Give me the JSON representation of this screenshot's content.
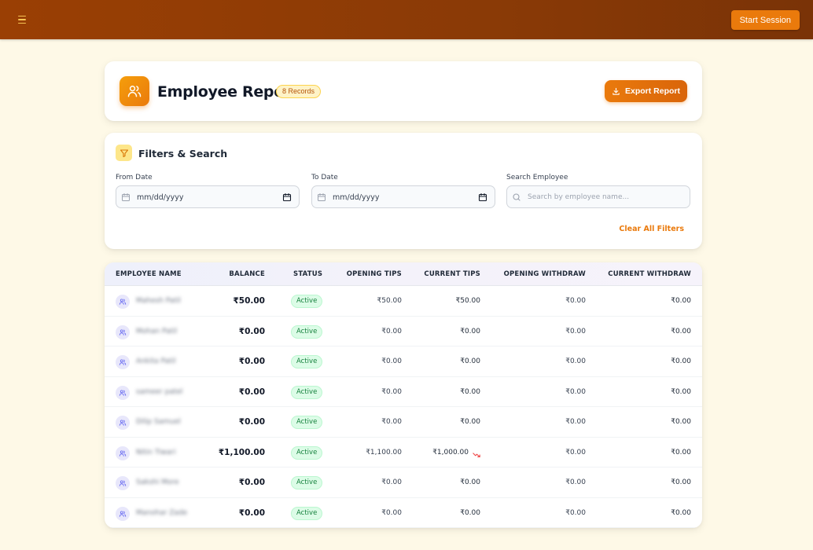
{
  "topbar": {
    "start_session_label": "Start Session"
  },
  "header": {
    "title": "Employee Report",
    "records_badge": "8 Records",
    "export_label": "Export Report"
  },
  "filters": {
    "title": "Filters & Search",
    "from_label": "From Date",
    "from_value": "mm/dd/yyyy",
    "to_label": "To Date",
    "to_value": "mm/dd/yyyy",
    "search_label": "Search Employee",
    "search_placeholder": "Search by employee name...",
    "clear_label": "Clear All Filters"
  },
  "table": {
    "headers": [
      "EMPLOYEE NAME",
      "BALANCE",
      "STATUS",
      "OPENING TIPS",
      "CURRENT TIPS",
      "OPENING WITHDRAW",
      "CURRENT WITHDRAW"
    ],
    "rows": [
      {
        "name": "Mahesh Patil",
        "balance": "₹50.00",
        "status": "Active",
        "opening_tips": "₹50.00",
        "current_tips": "₹50.00",
        "opening_withdraw": "₹0.00",
        "current_withdraw": "₹0.00"
      },
      {
        "name": "Mohan Patil",
        "balance": "₹0.00",
        "status": "Active",
        "opening_tips": "₹0.00",
        "current_tips": "₹0.00",
        "opening_withdraw": "₹0.00",
        "current_withdraw": "₹0.00"
      },
      {
        "name": "Ankita Patil",
        "balance": "₹0.00",
        "status": "Active",
        "opening_tips": "₹0.00",
        "current_tips": "₹0.00",
        "opening_withdraw": "₹0.00",
        "current_withdraw": "₹0.00"
      },
      {
        "name": "sameer patel",
        "balance": "₹0.00",
        "status": "Active",
        "opening_tips": "₹0.00",
        "current_tips": "₹0.00",
        "opening_withdraw": "₹0.00",
        "current_withdraw": "₹0.00"
      },
      {
        "name": "Dilip Samuel",
        "balance": "₹0.00",
        "status": "Active",
        "opening_tips": "₹0.00",
        "current_tips": "₹0.00",
        "opening_withdraw": "₹0.00",
        "current_withdraw": "₹0.00"
      },
      {
        "name": "Nitin Tiwari",
        "balance": "₹1,100.00",
        "status": "Active",
        "opening_tips": "₹1,100.00",
        "current_tips": "₹1,000.00",
        "opening_withdraw": "₹0.00",
        "current_withdraw": "₹0.00",
        "trend": "down"
      },
      {
        "name": "Sakshi More",
        "balance": "₹0.00",
        "status": "Active",
        "opening_tips": "₹0.00",
        "current_tips": "₹0.00",
        "opening_withdraw": "₹0.00",
        "current_withdraw": "₹0.00"
      },
      {
        "name": "Manohar Zade",
        "balance": "₹0.00",
        "status": "Active",
        "opening_tips": "₹0.00",
        "current_tips": "₹0.00",
        "opening_withdraw": "₹0.00",
        "current_withdraw": "₹0.00"
      }
    ]
  },
  "colors": {
    "accent": "#ea7a0c",
    "topbar": "#8a3a06",
    "background": "#fef9e7",
    "active_green": "#15803d",
    "trend_down": "#ef4444"
  },
  "icons": {
    "menu": "hamburger-icon",
    "header": "users-icon",
    "export": "download-icon",
    "filter": "funnel-icon",
    "calendar": "calendar-icon",
    "search": "search-icon",
    "avatar": "users-icon",
    "trend": "trending-down-icon"
  }
}
